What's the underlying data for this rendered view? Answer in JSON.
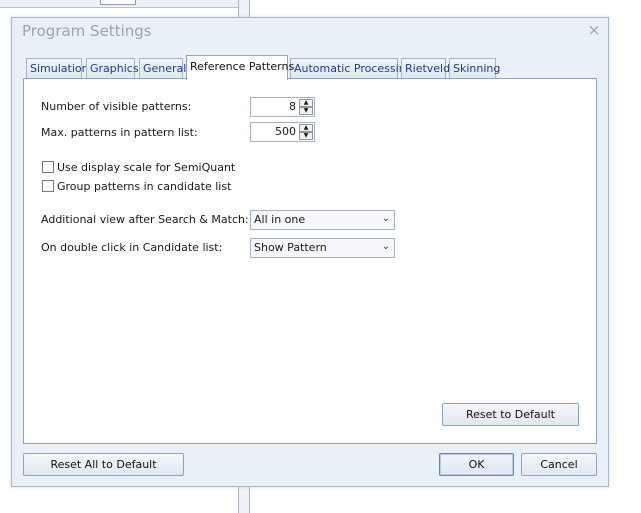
{
  "dialog": {
    "title": "Program Settings",
    "close_glyph": "×"
  },
  "tabs": [
    {
      "label": "Simulation"
    },
    {
      "label": "Graphics"
    },
    {
      "label": "General"
    },
    {
      "label": "Reference Patterns",
      "active": true
    },
    {
      "label": "Automatic Processing"
    },
    {
      "label": "Rietveld"
    },
    {
      "label": "Skinning"
    }
  ],
  "reference_patterns": {
    "visible_patterns_label": "Number of visible patterns:",
    "visible_patterns_value": "8",
    "max_patterns_label": "Max. patterns in pattern list:",
    "max_patterns_value": "500",
    "use_display_scale_label": "Use display scale for SemiQuant",
    "use_display_scale_checked": false,
    "group_patterns_label": "Group patterns in candidate  list",
    "group_patterns_checked": false,
    "additional_view_label": "Additional view after Search & Match:",
    "additional_view_value": "All in one",
    "double_click_label": "On double click in Candidate list:",
    "double_click_value": "Show Pattern",
    "reset_to_default_label": "Reset to Default"
  },
  "footer": {
    "reset_all_label": "Reset All to Default",
    "ok_label": "OK",
    "cancel_label": "Cancel"
  },
  "icons": {
    "spin_up": "▲",
    "spin_down": "▼",
    "dropdown": "⌄"
  },
  "colors": {
    "dialog_bg": "#eaf0f7",
    "tab_text": "#1f3c88",
    "title_text": "#9aa3ad"
  }
}
